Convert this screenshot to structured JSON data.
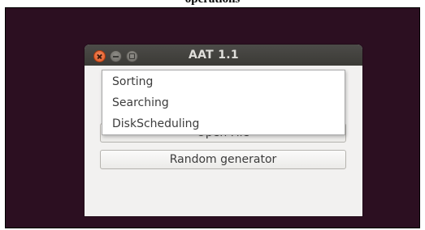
{
  "caption": "operations",
  "window": {
    "title": "AAT 1.1",
    "controls": {
      "close_icon": "close-icon",
      "minimize_icon": "minimize-icon",
      "maximize_icon": "maximize-icon"
    }
  },
  "buttons": {
    "open_file": "Open File",
    "random_generator": "Random generator"
  },
  "menu": {
    "items": [
      {
        "label": "Sorting"
      },
      {
        "label": "Searching"
      },
      {
        "label": "DiskScheduling"
      }
    ]
  },
  "colors": {
    "desktop_bg": "#2c0f21",
    "titlebar_bg": "#3b3a36",
    "window_bg": "#f2f1f0",
    "close_button": "#e0521f"
  }
}
